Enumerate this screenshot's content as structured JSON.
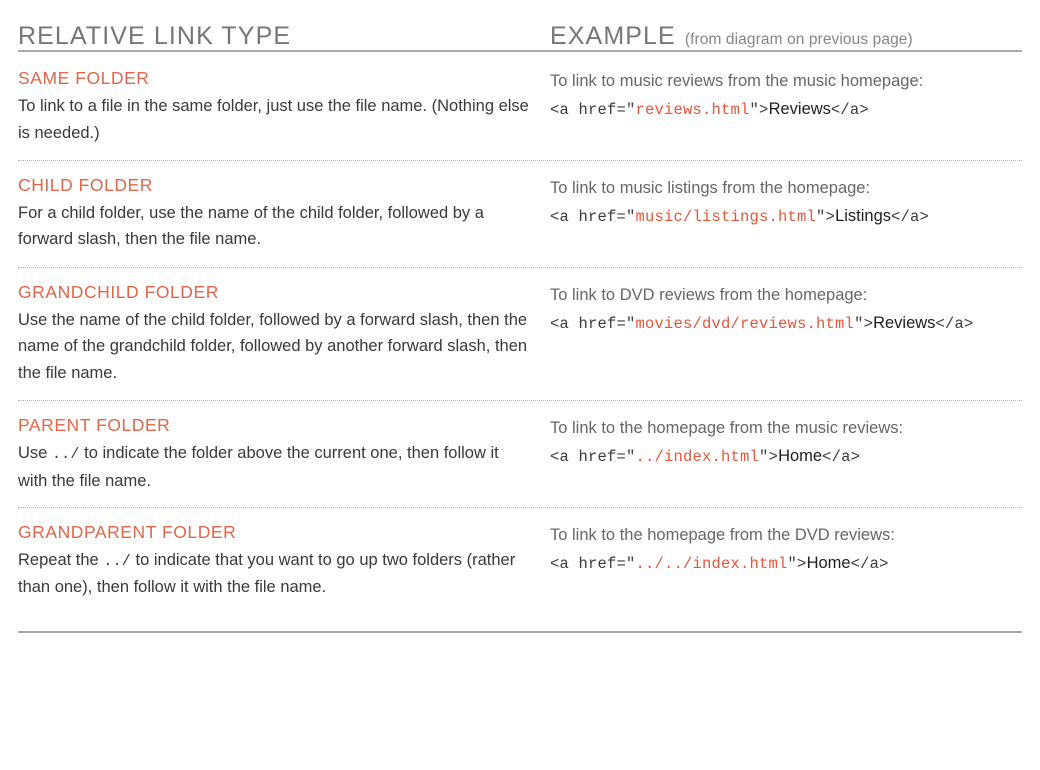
{
  "header": {
    "left_title": "RELATIVE LINK TYPE",
    "right_title": "EXAMPLE",
    "right_note": "(from diagram on previous page)"
  },
  "colors": {
    "accent": "#e0674a",
    "code_value": "#e4563a",
    "body_text": "#39393c",
    "muted_text": "#76767a",
    "rule": "#a9a9ac",
    "dotted_rule": "#b6b6b8"
  },
  "rows": [
    {
      "title": "SAME FOLDER",
      "description_part1": "To link to a file in the same folder, just use the file name. (Nothing else is needed.)",
      "description_mono": "",
      "description_part2": "",
      "example_caption": "To link to music reviews from the music homepage:",
      "code_open": "<a href=\"",
      "code_value": "reviews.html",
      "code_close": "\">",
      "code_text": "Reviews",
      "code_end": "</a>"
    },
    {
      "title": "CHILD FOLDER",
      "description_part1": "For a child folder, use the name of the child folder, followed by a forward slash, then the file name.",
      "description_mono": "",
      "description_part2": "",
      "example_caption": "To link to music listings from the homepage:",
      "code_open": "<a href=\"",
      "code_value": "music/listings.html",
      "code_close": "\">",
      "code_text": "Listings",
      "code_end": "</a>"
    },
    {
      "title": "GRANDCHILD FOLDER",
      "description_part1": "Use the name of the child folder, followed by a forward slash, then the name of the grandchild folder, followed by another forward slash, then the file name.",
      "description_mono": "",
      "description_part2": "",
      "example_caption": "To link to DVD reviews from the homepage:",
      "code_open": "<a href=\"",
      "code_value": "movies/dvd/reviews.html",
      "code_close": "\">",
      "code_text": "Reviews",
      "code_end": "</a>"
    },
    {
      "title": "PARENT FOLDER",
      "description_part1": "Use ",
      "description_mono": "../",
      "description_part2": " to indicate the folder above the current one, then follow it with the file name.",
      "example_caption": "To link to the homepage from the music reviews:",
      "code_open": "<a href=\"",
      "code_value": "../index.html",
      "code_close": "\">",
      "code_text": "Home",
      "code_end": "</a>"
    },
    {
      "title": "GRANDPARENT FOLDER",
      "description_part1": "Repeat the ",
      "description_mono": "../",
      "description_part2": " to indicate that you want to go up two folders (rather than one), then follow it with the file name.",
      "example_caption": "To link to the homepage from the DVD reviews:",
      "code_open": "<a href=\"",
      "code_value": "../../index.html",
      "code_close": "\">",
      "code_text": "Home",
      "code_end": "</a>"
    }
  ]
}
